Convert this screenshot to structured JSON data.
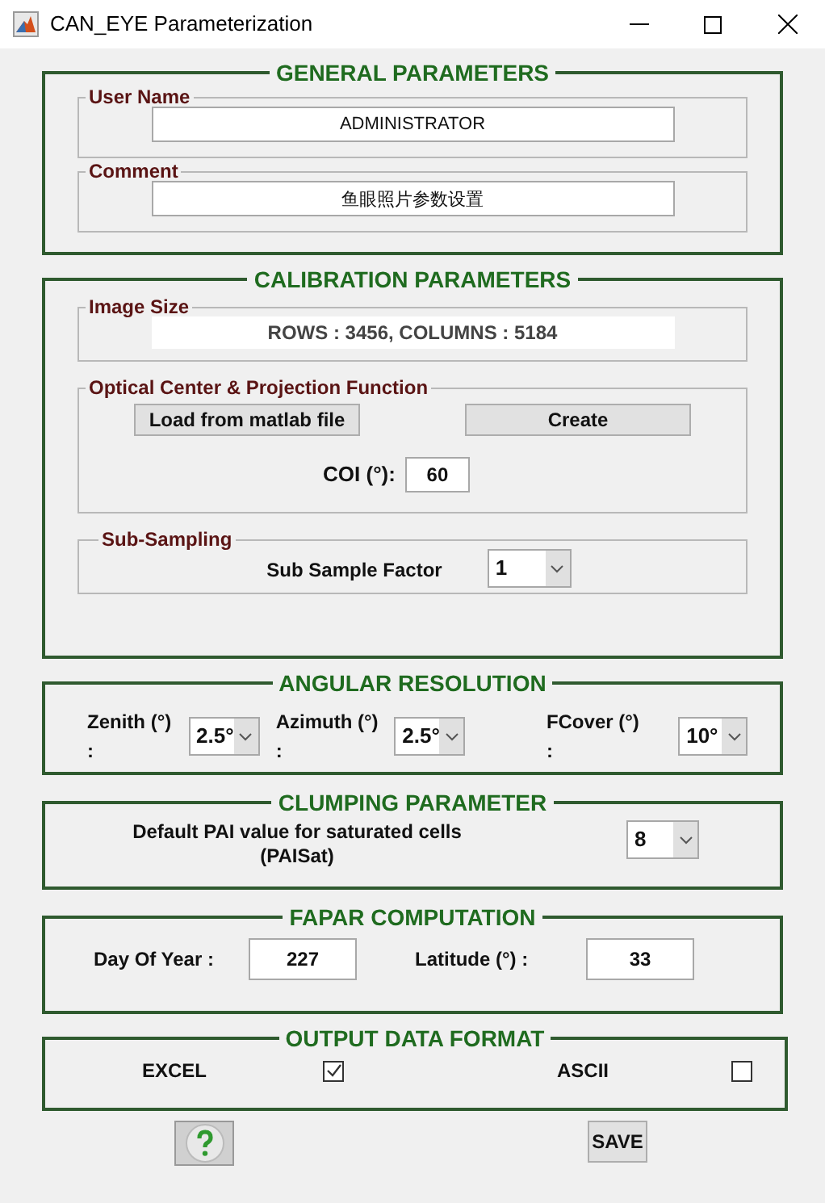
{
  "window": {
    "title": "CAN_EYE Parameterization"
  },
  "general_parameters": {
    "title": "GENERAL PARAMETERS",
    "user_name": {
      "label": "User Name",
      "value": "ADMINISTRATOR"
    },
    "comment": {
      "label": "Comment",
      "value": "鱼眼照片参数设置"
    }
  },
  "calibration_parameters": {
    "title": "CALIBRATION PARAMETERS",
    "image_size": {
      "label": "Image Size",
      "value": "ROWS : 3456, COLUMNS : 5184"
    },
    "optical_center": {
      "label": "Optical Center & Projection Function",
      "buttons": [
        "Load from matlab file",
        "Create"
      ],
      "coi": {
        "label": "COI (°):",
        "value": "60"
      }
    },
    "sub_sampling": {
      "label": "Sub-Sampling",
      "factor": {
        "label": "Sub Sample Factor",
        "value": "1"
      }
    }
  },
  "angular_resolution": {
    "title": "ANGULAR RESOLUTION",
    "fields": [
      {
        "label": "Zenith (°) :",
        "value": "2.5°"
      },
      {
        "label": "Azimuth (°) :",
        "value": "2.5°"
      },
      {
        "label": "FCover (°) :",
        "value": "10°"
      }
    ]
  },
  "clumping_parameter": {
    "title": "CLUMPING PARAMETER",
    "label": "Default PAI value for saturated cells\n(PAISat)",
    "value": "8"
  },
  "fapar_computation": {
    "title": "FAPAR COMPUTATION",
    "fields": [
      {
        "label": "Day Of Year :",
        "value": "227"
      },
      {
        "label": "Latitude (°) :",
        "value": "33"
      }
    ]
  },
  "output_data_format": {
    "title": "OUTPUT DATA FORMAT",
    "options": [
      {
        "label": "EXCEL",
        "checked": true
      },
      {
        "label": "ASCII",
        "checked": false
      }
    ]
  },
  "save_button": "SAVE"
}
